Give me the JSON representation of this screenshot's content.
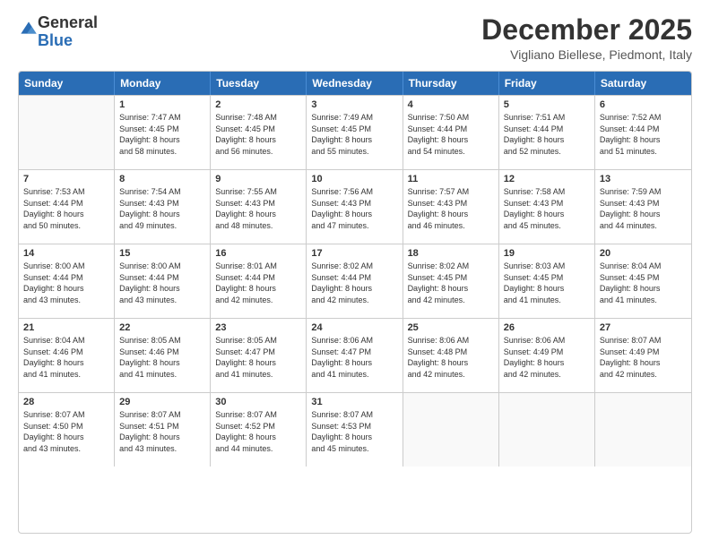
{
  "logo": {
    "general": "General",
    "blue": "Blue"
  },
  "header": {
    "month": "December 2025",
    "location": "Vigliano Biellese, Piedmont, Italy"
  },
  "days": [
    "Sunday",
    "Monday",
    "Tuesday",
    "Wednesday",
    "Thursday",
    "Friday",
    "Saturday"
  ],
  "weeks": [
    [
      {
        "day": "",
        "empty": true
      },
      {
        "day": "1",
        "sunrise": "7:47 AM",
        "sunset": "4:45 PM",
        "daylight": "8 hours and 58 minutes."
      },
      {
        "day": "2",
        "sunrise": "7:48 AM",
        "sunset": "4:45 PM",
        "daylight": "8 hours and 56 minutes."
      },
      {
        "day": "3",
        "sunrise": "7:49 AM",
        "sunset": "4:45 PM",
        "daylight": "8 hours and 55 minutes."
      },
      {
        "day": "4",
        "sunrise": "7:50 AM",
        "sunset": "4:44 PM",
        "daylight": "8 hours and 54 minutes."
      },
      {
        "day": "5",
        "sunrise": "7:51 AM",
        "sunset": "4:44 PM",
        "daylight": "8 hours and 52 minutes."
      },
      {
        "day": "6",
        "sunrise": "7:52 AM",
        "sunset": "4:44 PM",
        "daylight": "8 hours and 51 minutes."
      }
    ],
    [
      {
        "day": "7",
        "sunrise": "7:53 AM",
        "sunset": "4:44 PM",
        "daylight": "8 hours and 50 minutes."
      },
      {
        "day": "8",
        "sunrise": "7:54 AM",
        "sunset": "4:43 PM",
        "daylight": "8 hours and 49 minutes."
      },
      {
        "day": "9",
        "sunrise": "7:55 AM",
        "sunset": "4:43 PM",
        "daylight": "8 hours and 48 minutes."
      },
      {
        "day": "10",
        "sunrise": "7:56 AM",
        "sunset": "4:43 PM",
        "daylight": "8 hours and 47 minutes."
      },
      {
        "day": "11",
        "sunrise": "7:57 AM",
        "sunset": "4:43 PM",
        "daylight": "8 hours and 46 minutes."
      },
      {
        "day": "12",
        "sunrise": "7:58 AM",
        "sunset": "4:43 PM",
        "daylight": "8 hours and 45 minutes."
      },
      {
        "day": "13",
        "sunrise": "7:59 AM",
        "sunset": "4:43 PM",
        "daylight": "8 hours and 44 minutes."
      }
    ],
    [
      {
        "day": "14",
        "sunrise": "8:00 AM",
        "sunset": "4:44 PM",
        "daylight": "8 hours and 43 minutes."
      },
      {
        "day": "15",
        "sunrise": "8:00 AM",
        "sunset": "4:44 PM",
        "daylight": "8 hours and 43 minutes."
      },
      {
        "day": "16",
        "sunrise": "8:01 AM",
        "sunset": "4:44 PM",
        "daylight": "8 hours and 42 minutes."
      },
      {
        "day": "17",
        "sunrise": "8:02 AM",
        "sunset": "4:44 PM",
        "daylight": "8 hours and 42 minutes."
      },
      {
        "day": "18",
        "sunrise": "8:02 AM",
        "sunset": "4:45 PM",
        "daylight": "8 hours and 42 minutes."
      },
      {
        "day": "19",
        "sunrise": "8:03 AM",
        "sunset": "4:45 PM",
        "daylight": "8 hours and 41 minutes."
      },
      {
        "day": "20",
        "sunrise": "8:04 AM",
        "sunset": "4:45 PM",
        "daylight": "8 hours and 41 minutes."
      }
    ],
    [
      {
        "day": "21",
        "sunrise": "8:04 AM",
        "sunset": "4:46 PM",
        "daylight": "8 hours and 41 minutes."
      },
      {
        "day": "22",
        "sunrise": "8:05 AM",
        "sunset": "4:46 PM",
        "daylight": "8 hours and 41 minutes."
      },
      {
        "day": "23",
        "sunrise": "8:05 AM",
        "sunset": "4:47 PM",
        "daylight": "8 hours and 41 minutes."
      },
      {
        "day": "24",
        "sunrise": "8:06 AM",
        "sunset": "4:47 PM",
        "daylight": "8 hours and 41 minutes."
      },
      {
        "day": "25",
        "sunrise": "8:06 AM",
        "sunset": "4:48 PM",
        "daylight": "8 hours and 42 minutes."
      },
      {
        "day": "26",
        "sunrise": "8:06 AM",
        "sunset": "4:49 PM",
        "daylight": "8 hours and 42 minutes."
      },
      {
        "day": "27",
        "sunrise": "8:07 AM",
        "sunset": "4:49 PM",
        "daylight": "8 hours and 42 minutes."
      }
    ],
    [
      {
        "day": "28",
        "sunrise": "8:07 AM",
        "sunset": "4:50 PM",
        "daylight": "8 hours and 43 minutes."
      },
      {
        "day": "29",
        "sunrise": "8:07 AM",
        "sunset": "4:51 PM",
        "daylight": "8 hours and 43 minutes."
      },
      {
        "day": "30",
        "sunrise": "8:07 AM",
        "sunset": "4:52 PM",
        "daylight": "8 hours and 44 minutes."
      },
      {
        "day": "31",
        "sunrise": "8:07 AM",
        "sunset": "4:53 PM",
        "daylight": "8 hours and 45 minutes."
      },
      {
        "day": "",
        "empty": true
      },
      {
        "day": "",
        "empty": true
      },
      {
        "day": "",
        "empty": true
      }
    ]
  ]
}
